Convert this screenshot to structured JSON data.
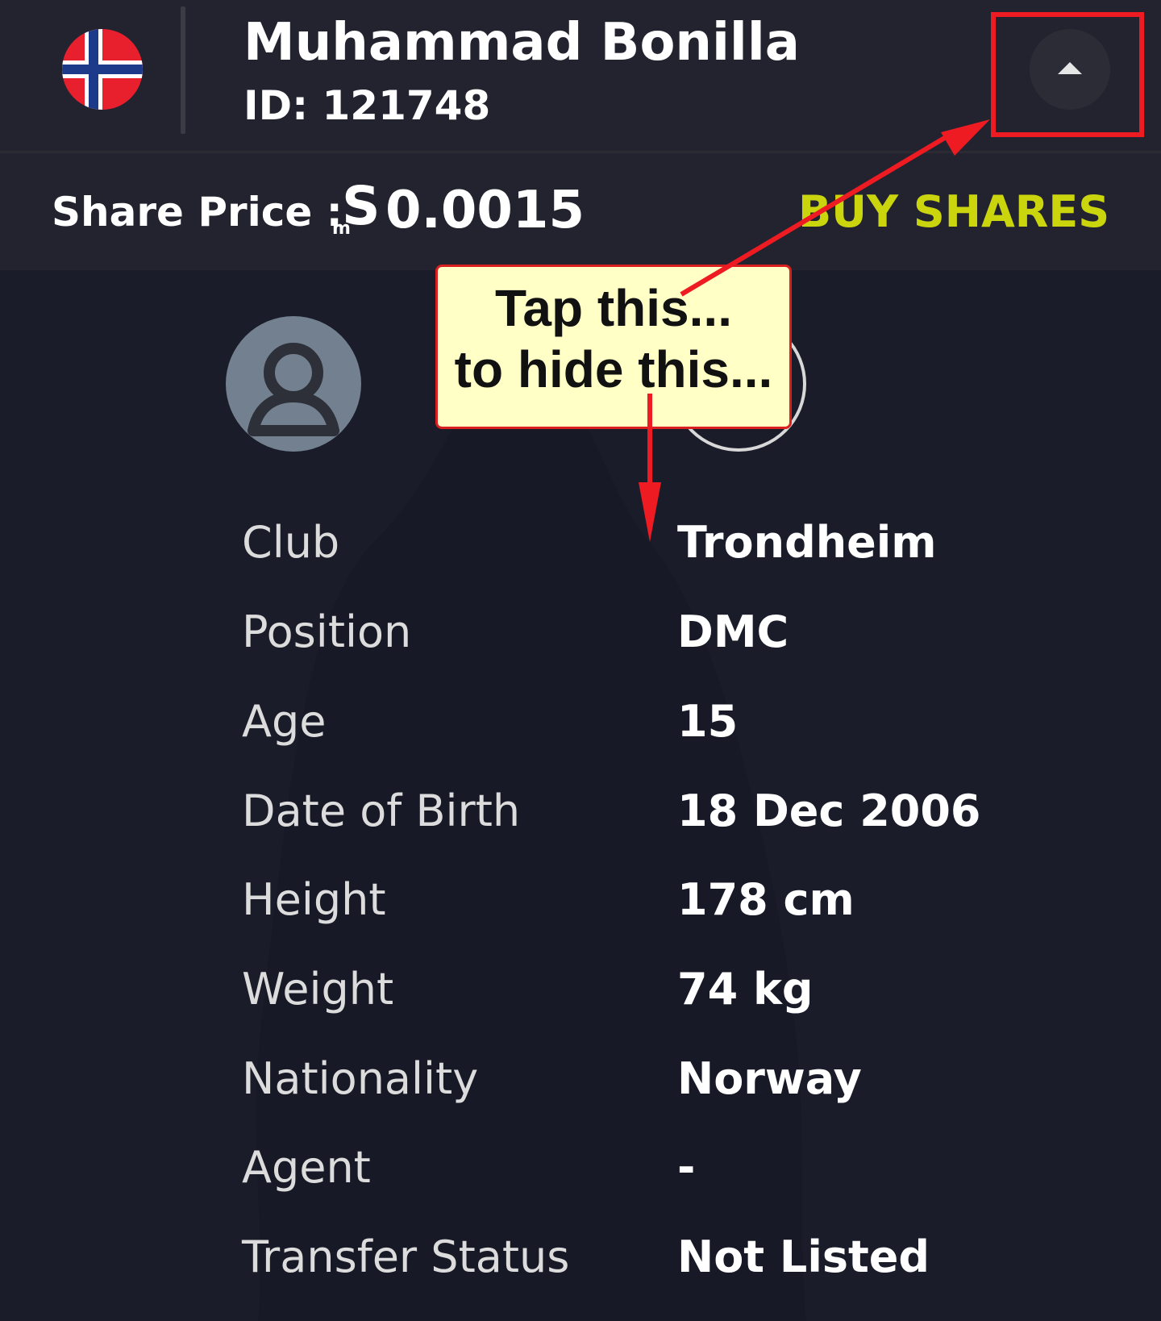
{
  "player": {
    "name": "Muhammad Bonilla",
    "id_text": "ID: 121748",
    "flag": "norway-flag"
  },
  "header": {
    "collapse_icon": "caret-up-icon"
  },
  "share": {
    "label": "Share Price :",
    "currency_icon": "currency-icon",
    "value": "0.0015",
    "buy_label": "BUY SHARES",
    "buy_color": "#cbd50e"
  },
  "details": [
    {
      "label": "Club",
      "value": "Trondheim"
    },
    {
      "label": "Position",
      "value": "DMC"
    },
    {
      "label": "Age",
      "value": "15"
    },
    {
      "label": "Date of Birth",
      "value": "18 Dec 2006"
    },
    {
      "label": "Height",
      "value": "178 cm"
    },
    {
      "label": "Weight",
      "value": "74 kg"
    },
    {
      "label": "Nationality",
      "value": "Norway"
    },
    {
      "label": "Agent",
      "value": "-"
    },
    {
      "label": "Transfer Status",
      "value": "Not Listed"
    }
  ],
  "annotation": {
    "line1": "Tap this...",
    "line2": "to hide this...",
    "color": "#ef1b22"
  }
}
